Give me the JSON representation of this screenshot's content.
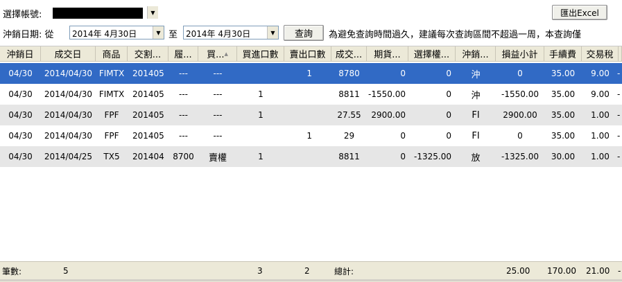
{
  "account": {
    "label": "選擇帳號:"
  },
  "export_button": "匯出Excel",
  "date_filter": {
    "label": "沖銷日期: 從",
    "from": "2014年  4月30日",
    "to_label": "至",
    "to": "2014年  4月30日",
    "query_button": "查詢",
    "note": "為避免查詢時間過久，建議每次查詢區間不超過一周，本查詢僅"
  },
  "columns": [
    "沖銷日",
    "成交日",
    "商品",
    "交割...",
    "履...",
    "買...",
    "買進口數",
    "賣出口數",
    "成交...",
    "期貨...",
    "選擇權...",
    "沖銷...",
    "損益小計",
    "手續費",
    "交易稅"
  ],
  "rows": [
    [
      "04/30",
      "2014/04/30",
      "FIMTX",
      "201405",
      "---",
      "---",
      "",
      "1",
      "8780",
      "0",
      "0",
      "沖",
      "0",
      "35.00",
      "9.00"
    ],
    [
      "04/30",
      "2014/04/30",
      "FIMTX",
      "201405",
      "---",
      "---",
      "1",
      "",
      "8811",
      "-1550.00",
      "0",
      "沖",
      "-1550.00",
      "35.00",
      "9.00"
    ],
    [
      "04/30",
      "2014/04/30",
      "FPF",
      "201405",
      "---",
      "---",
      "1",
      "",
      "27.55",
      "2900.00",
      "0",
      "FI",
      "2900.00",
      "35.00",
      "1.00"
    ],
    [
      "04/30",
      "2014/04/30",
      "FPF",
      "201405",
      "---",
      "---",
      "",
      "1",
      "29",
      "0",
      "0",
      "FI",
      "0",
      "35.00",
      "1.00"
    ],
    [
      "04/30",
      "2014/04/25",
      "TX5",
      "201404",
      "8700",
      "賣權",
      "1",
      "",
      "8811",
      "0",
      "-1325.00",
      "放",
      "-1325.00",
      "30.00",
      "1.00"
    ]
  ],
  "row_trailing_mark": "-",
  "footer": {
    "count_label": "筆數:",
    "count": "5",
    "buy_total": "3",
    "sell_total": "2",
    "total_label": "總計:",
    "pl_total": "25.00",
    "fee_total": "170.00",
    "tax_total": "21.00",
    "trailing": "-"
  },
  "selected_row": 0,
  "colors": {
    "selection": "#316ac5",
    "header_bg": "#ece9d8",
    "alt_row": "#e6e6e6"
  }
}
